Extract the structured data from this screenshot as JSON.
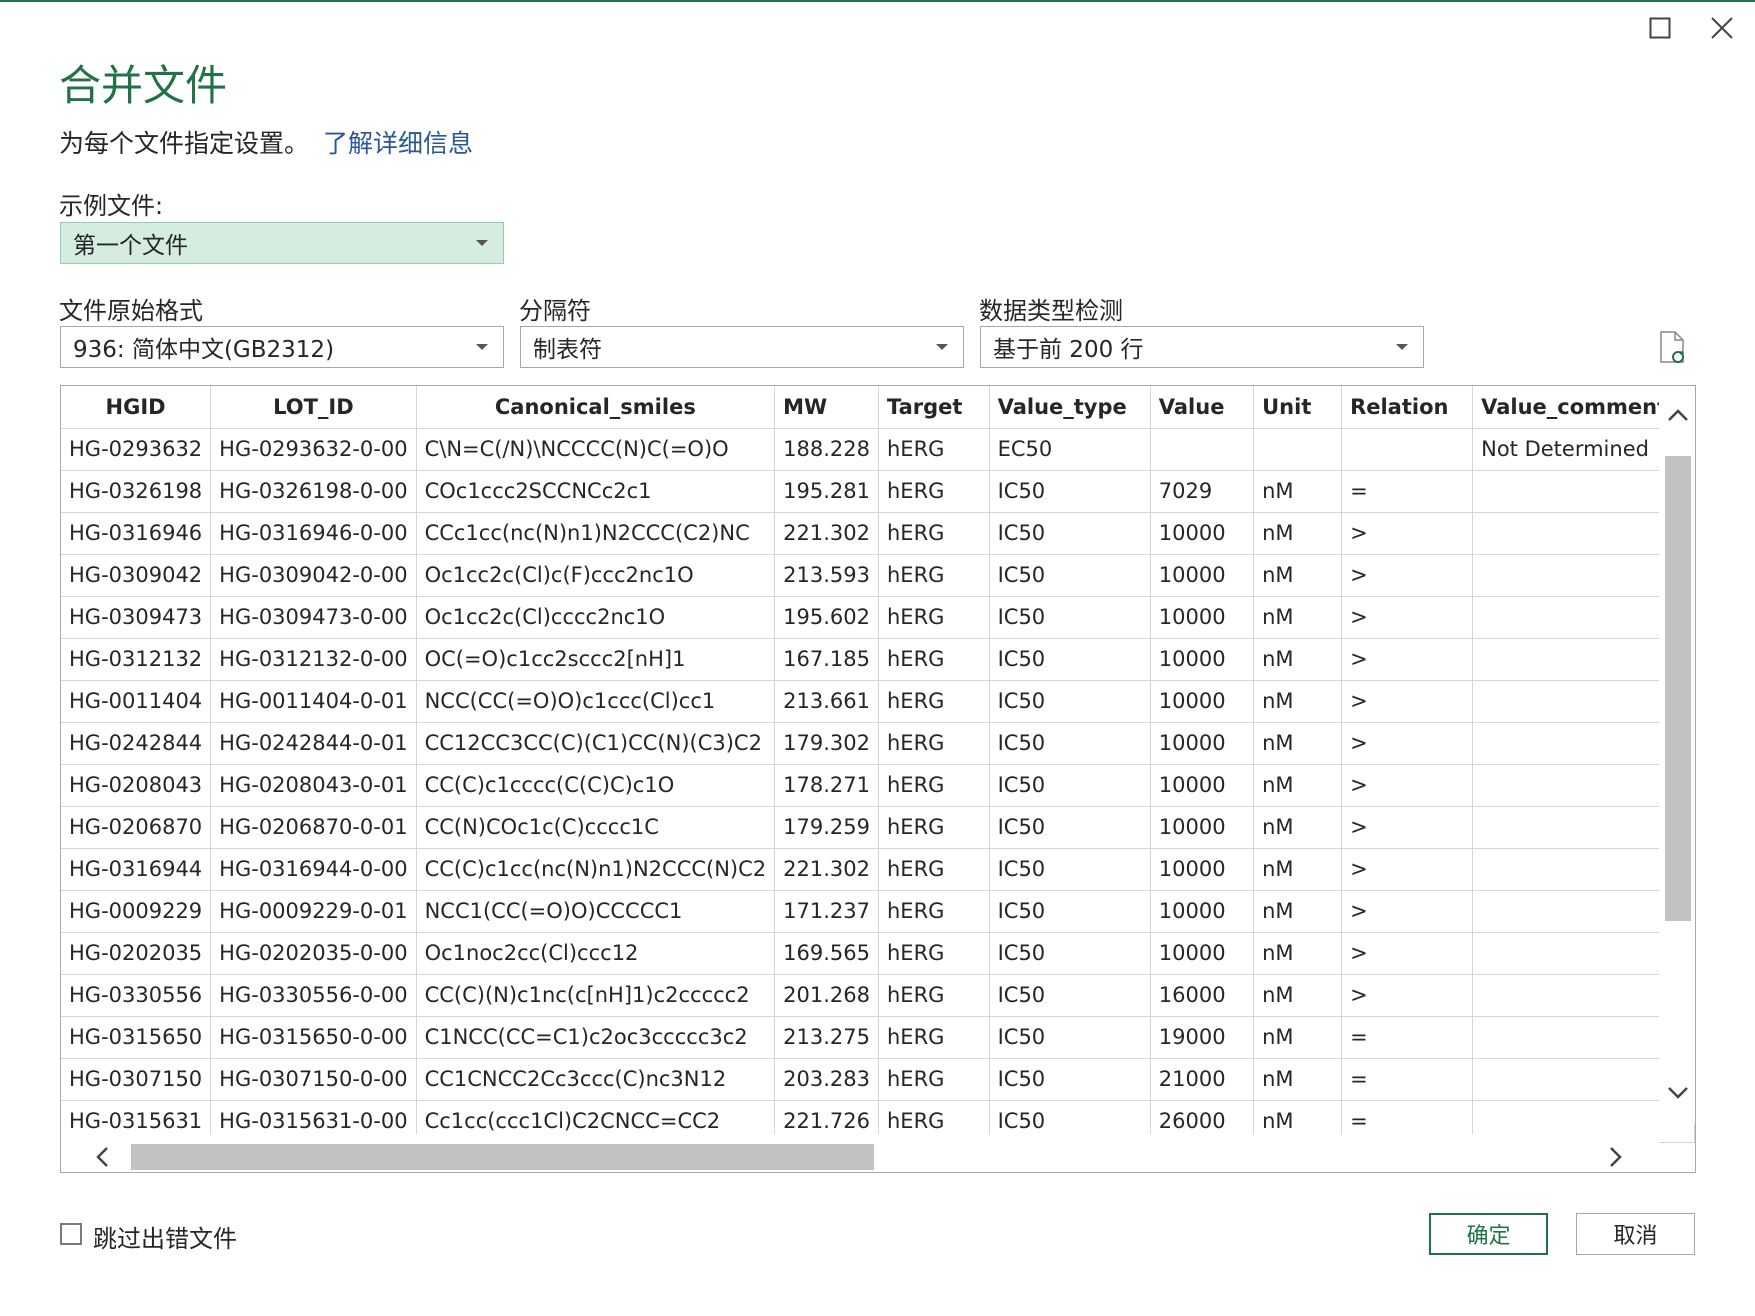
{
  "dialog": {
    "title": "合并文件",
    "subtitle": "为每个文件指定设置。",
    "learn_more_link": "了解详细信息"
  },
  "sample_file": {
    "label": "示例文件:",
    "value": "第一个文件"
  },
  "file_origin": {
    "label": "文件原始格式",
    "value": "936: 简体中文(GB2312)"
  },
  "delimiter": {
    "label": "分隔符",
    "value": "制表符"
  },
  "type_detection": {
    "label": "数据类型检测",
    "value": "基于前 200 行"
  },
  "table": {
    "columns": [
      "HGID",
      "LOT_ID",
      "Canonical_smiles",
      "MW",
      "Target",
      "Value_type",
      "Value",
      "Unit",
      "Relation",
      "Value_comments"
    ],
    "rows": [
      [
        "HG-0293632",
        "HG-0293632-0-00",
        "C\\N=C(/N)\\NCCCC(N)C(=O)O",
        "188.228",
        "hERG",
        "EC50",
        "",
        "",
        "",
        "Not Determined"
      ],
      [
        "HG-0326198",
        "HG-0326198-0-00",
        "COc1ccc2SCCNCc2c1",
        "195.281",
        "hERG",
        "IC50",
        "7029",
        "nM",
        "=",
        ""
      ],
      [
        "HG-0316946",
        "HG-0316946-0-00",
        "CCc1cc(nc(N)n1)N2CCC(C2)NC",
        "221.302",
        "hERG",
        "IC50",
        "10000",
        "nM",
        ">",
        ""
      ],
      [
        "HG-0309042",
        "HG-0309042-0-00",
        "Oc1cc2c(Cl)c(F)ccc2nc1O",
        "213.593",
        "hERG",
        "IC50",
        "10000",
        "nM",
        ">",
        ""
      ],
      [
        "HG-0309473",
        "HG-0309473-0-00",
        "Oc1cc2c(Cl)cccc2nc1O",
        "195.602",
        "hERG",
        "IC50",
        "10000",
        "nM",
        ">",
        ""
      ],
      [
        "HG-0312132",
        "HG-0312132-0-00",
        "OC(=O)c1cc2sccc2[nH]1",
        "167.185",
        "hERG",
        "IC50",
        "10000",
        "nM",
        ">",
        ""
      ],
      [
        "HG-0011404",
        "HG-0011404-0-01",
        "NCC(CC(=O)O)c1ccc(Cl)cc1",
        "213.661",
        "hERG",
        "IC50",
        "10000",
        "nM",
        ">",
        ""
      ],
      [
        "HG-0242844",
        "HG-0242844-0-01",
        "CC12CC3CC(C)(C1)CC(N)(C3)C2",
        "179.302",
        "hERG",
        "IC50",
        "10000",
        "nM",
        ">",
        ""
      ],
      [
        "HG-0208043",
        "HG-0208043-0-01",
        "CC(C)c1cccc(C(C)C)c1O",
        "178.271",
        "hERG",
        "IC50",
        "10000",
        "nM",
        ">",
        ""
      ],
      [
        "HG-0206870",
        "HG-0206870-0-01",
        "CC(N)COc1c(C)cccc1C",
        "179.259",
        "hERG",
        "IC50",
        "10000",
        "nM",
        ">",
        ""
      ],
      [
        "HG-0316944",
        "HG-0316944-0-00",
        "CC(C)c1cc(nc(N)n1)N2CCC(N)C2",
        "221.302",
        "hERG",
        "IC50",
        "10000",
        "nM",
        ">",
        ""
      ],
      [
        "HG-0009229",
        "HG-0009229-0-01",
        "NCC1(CC(=O)O)CCCCC1",
        "171.237",
        "hERG",
        "IC50",
        "10000",
        "nM",
        ">",
        ""
      ],
      [
        "HG-0202035",
        "HG-0202035-0-00",
        "Oc1noc2cc(Cl)ccc12",
        "169.565",
        "hERG",
        "IC50",
        "10000",
        "nM",
        ">",
        ""
      ],
      [
        "HG-0330556",
        "HG-0330556-0-00",
        "CC(C)(N)c1nc(c[nH]1)c2ccccc2",
        "201.268",
        "hERG",
        "IC50",
        "16000",
        "nM",
        ">",
        ""
      ],
      [
        "HG-0315650",
        "HG-0315650-0-00",
        "C1NCC(CC=C1)c2oc3ccccc3c2",
        "213.275",
        "hERG",
        "IC50",
        "19000",
        "nM",
        "=",
        ""
      ],
      [
        "HG-0307150",
        "HG-0307150-0-00",
        "CC1CNCC2Cc3ccc(C)nc3N12",
        "203.283",
        "hERG",
        "IC50",
        "21000",
        "nM",
        "=",
        ""
      ],
      [
        "HG-0315631",
        "HG-0315631-0-00",
        "Cc1cc(ccc1Cl)C2CNCC=CC2",
        "221.726",
        "hERG",
        "IC50",
        "26000",
        "nM",
        "=",
        ""
      ]
    ]
  },
  "skip_errors": {
    "label": "跳过出错文件",
    "checked": false
  },
  "buttons": {
    "ok": "确定",
    "cancel": "取消"
  },
  "icons": {
    "maximize": "maximize-icon",
    "close": "close-icon",
    "refresh": "refresh-preview-icon"
  },
  "colors": {
    "accent": "#217346",
    "link": "#2b5797",
    "selected_bg": "#d5ede0"
  }
}
